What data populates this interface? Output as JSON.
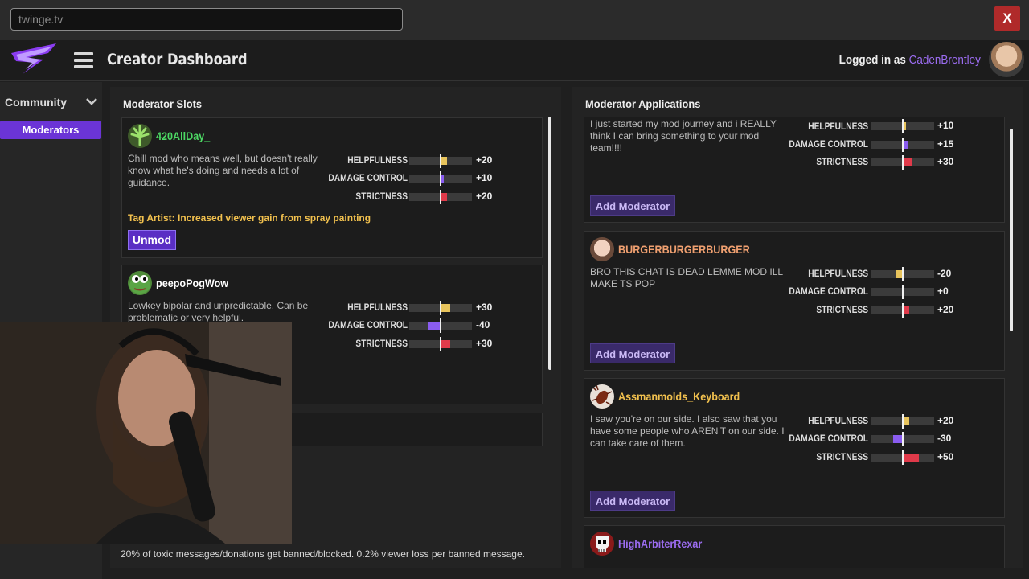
{
  "browser": {
    "url": "twinge.tv",
    "close_label": "X"
  },
  "header": {
    "title": "Creator Dashboard",
    "logged_in_prefix": "Logged in as",
    "username": "CadenBrentley"
  },
  "sidebar": {
    "section": "Community",
    "items": [
      {
        "label": "Moderators",
        "active": true
      }
    ]
  },
  "slots": {
    "title": "Moderator Slots",
    "cards": [
      {
        "name": "420AllDay_",
        "name_color": "#4cd964",
        "avatar_icon": "weed-leaf-icon",
        "description": "Chill mod who means well, but doesn't really know what he's doing and needs a lot of guidance.",
        "stats": [
          {
            "label": "HELPFULNESS",
            "value": "+20",
            "amount": 20
          },
          {
            "label": "DAMAGE CONTROL",
            "value": "+10",
            "amount": 10
          },
          {
            "label": "STRICTNESS",
            "value": "+20",
            "amount": 20
          }
        ],
        "tag": "Tag Artist: Increased viewer gain from spray painting",
        "button": "Unmod"
      },
      {
        "name": "peepoPogWow",
        "name_color": "#ffffff",
        "avatar_icon": "pepe-frog-icon",
        "description": "Lowkey bipolar and unpredictable. Can be problematic or very helpful.",
        "stats": [
          {
            "label": "HELPFULNESS",
            "value": "+30",
            "amount": 30
          },
          {
            "label": "DAMAGE CONTROL",
            "value": "-40",
            "amount": -40
          },
          {
            "label": "STRICTNESS",
            "value": "+30",
            "amount": 30
          }
        ]
      }
    ],
    "footer": "20% of toxic messages/donations get banned/blocked. 0.2% viewer loss per banned message."
  },
  "applications": {
    "title": "Moderator Applications",
    "button": "Add Moderator",
    "cards": [
      {
        "name": "",
        "description": "I just started my mod journey and i REALLY think I can bring something to your mod team!!!!",
        "stats": [
          {
            "label": "HELPFULNESS",
            "value": "+10",
            "amount": 10
          },
          {
            "label": "DAMAGE CONTROL",
            "value": "+15",
            "amount": 15
          },
          {
            "label": "STRICTNESS",
            "value": "+30",
            "amount": 30
          }
        ]
      },
      {
        "name": "BURGERBURGERBURGER",
        "name_color": "#f0a070",
        "avatar_icon": "person-avatar-icon",
        "description": "BRO THIS CHAT IS DEAD LEMME MOD ILL MAKE TS POP",
        "stats": [
          {
            "label": "HELPFULNESS",
            "value": "-20",
            "amount": -20
          },
          {
            "label": "DAMAGE CONTROL",
            "value": "+0",
            "amount": 0
          },
          {
            "label": "STRICTNESS",
            "value": "+20",
            "amount": 20
          }
        ]
      },
      {
        "name": "Assmanmolds_Keyboard",
        "name_color": "#f2c14e",
        "avatar_icon": "cockroach-icon",
        "description": "I saw you're on our side. I also saw that you have some people who AREN'T on our side. I can take care of them.",
        "stats": [
          {
            "label": "HELPFULNESS",
            "value": "+20",
            "amount": 20
          },
          {
            "label": "DAMAGE CONTROL",
            "value": "-30",
            "amount": -30
          },
          {
            "label": "STRICTNESS",
            "value": "+50",
            "amount": 50
          }
        ]
      },
      {
        "name": "HighArbiterRexar",
        "name_color": "#9b6cf0",
        "avatar_icon": "skull-icon"
      }
    ]
  },
  "colors": {
    "accent": "#6b34d6",
    "helpfulness": "#e8c45c",
    "damage_control": "#8a5cf0",
    "strictness": "#e03a4a"
  }
}
